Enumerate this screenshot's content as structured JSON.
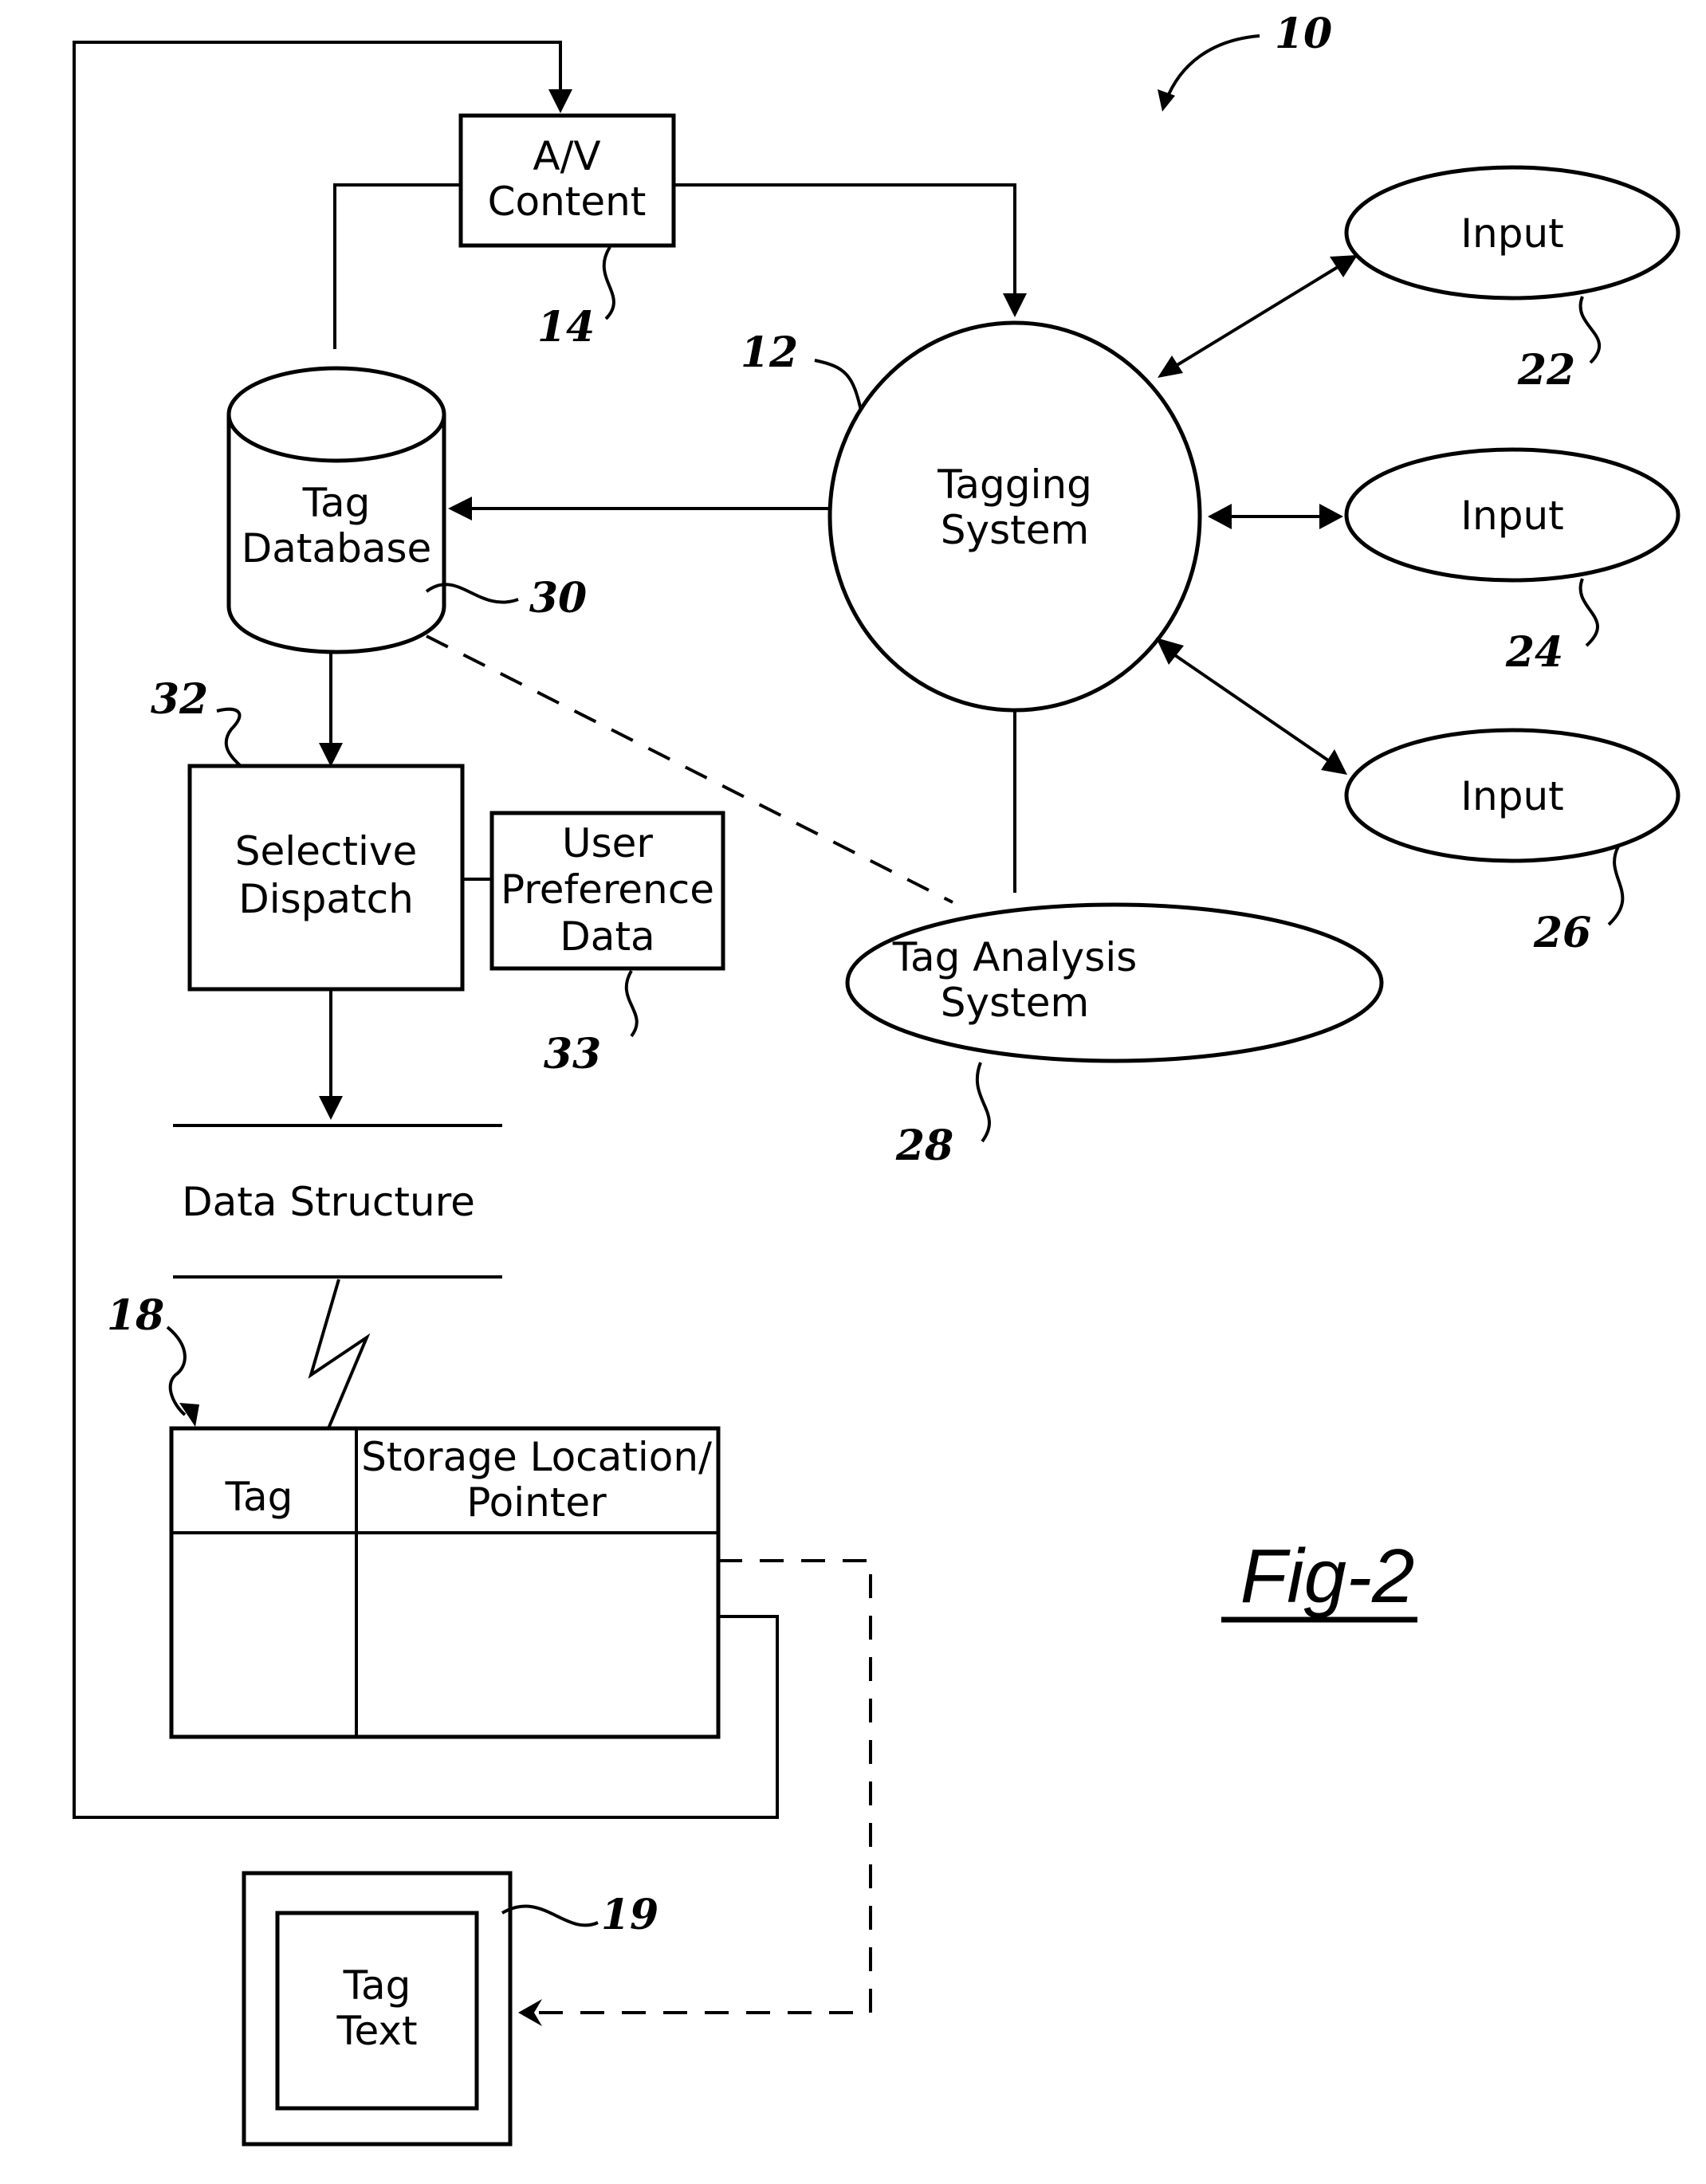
{
  "figure": {
    "label": "Fig-2",
    "system_ref": "10"
  },
  "nodes": {
    "av_content": {
      "lines": [
        "A/V",
        "Content"
      ],
      "ref": "14"
    },
    "tagging_system": {
      "lines": [
        "Tagging",
        "System"
      ],
      "ref": "12"
    },
    "input_1": {
      "label": "Input",
      "ref": "22"
    },
    "input_2": {
      "label": "Input",
      "ref": "24"
    },
    "input_3": {
      "label": "Input",
      "ref": "26"
    },
    "tag_database": {
      "lines": [
        "Tag",
        "Database"
      ],
      "ref": "30"
    },
    "selective_dispatch": {
      "lines": [
        "Selective",
        "Dispatch"
      ],
      "ref": "32"
    },
    "user_preference": {
      "lines": [
        "User",
        "Preference",
        "Data"
      ],
      "ref": "33"
    },
    "tag_analysis": {
      "lines": [
        "Tag Analysis",
        "System"
      ],
      "ref": "28"
    },
    "data_structure": {
      "label": "Data Structure"
    },
    "table": {
      "ref": "18",
      "col1_header": "Tag",
      "col2_header_lines": [
        "Storage Location/",
        "Pointer"
      ]
    },
    "tag_text": {
      "lines": [
        "Tag",
        "Text"
      ],
      "ref": "19"
    }
  },
  "colors": {
    "stroke": "#000000",
    "background": "#ffffff"
  }
}
